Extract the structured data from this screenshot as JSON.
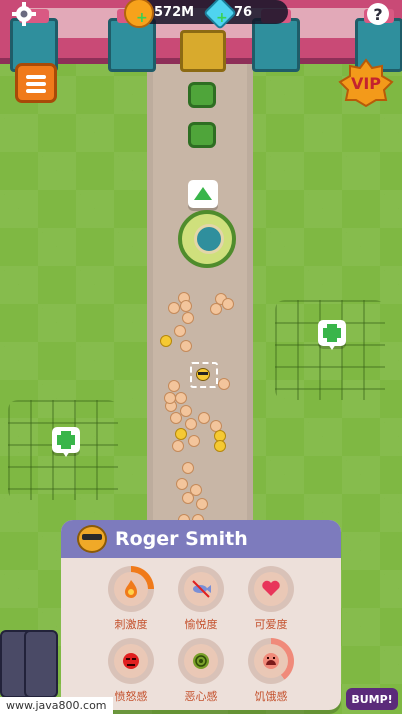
{
  "hud": {
    "coins": "572M",
    "gems": "76",
    "help_label": "?",
    "vip_label": "VIP",
    "settings_icon": "gear-icon",
    "menu_icon": "list-icon"
  },
  "panel": {
    "name": "Roger Smith",
    "stats": [
      {
        "label": "刺激度",
        "icon": "fire-icon",
        "progress": 0.25,
        "color": "#f07a1a"
      },
      {
        "label": "愉悦度",
        "icon": "fish-icon",
        "progress": 0.0,
        "color": "#7a8fd6"
      },
      {
        "label": "可爱度",
        "icon": "heart-icon",
        "progress": 0.0,
        "color": "#e8355a"
      },
      {
        "label": "愤怒感",
        "icon": "angry-face-icon",
        "progress": 0.0,
        "color": "#e02020"
      },
      {
        "label": "恶心感",
        "icon": "spiral-icon",
        "progress": 0.0,
        "color": "#7aa02a"
      },
      {
        "label": "饥饿感",
        "icon": "hungry-face-icon",
        "progress": 0.4,
        "color": "#f08a7a"
      }
    ]
  },
  "footer": {
    "watermark": "www.java800.com",
    "bump_label": "BUMP!"
  }
}
